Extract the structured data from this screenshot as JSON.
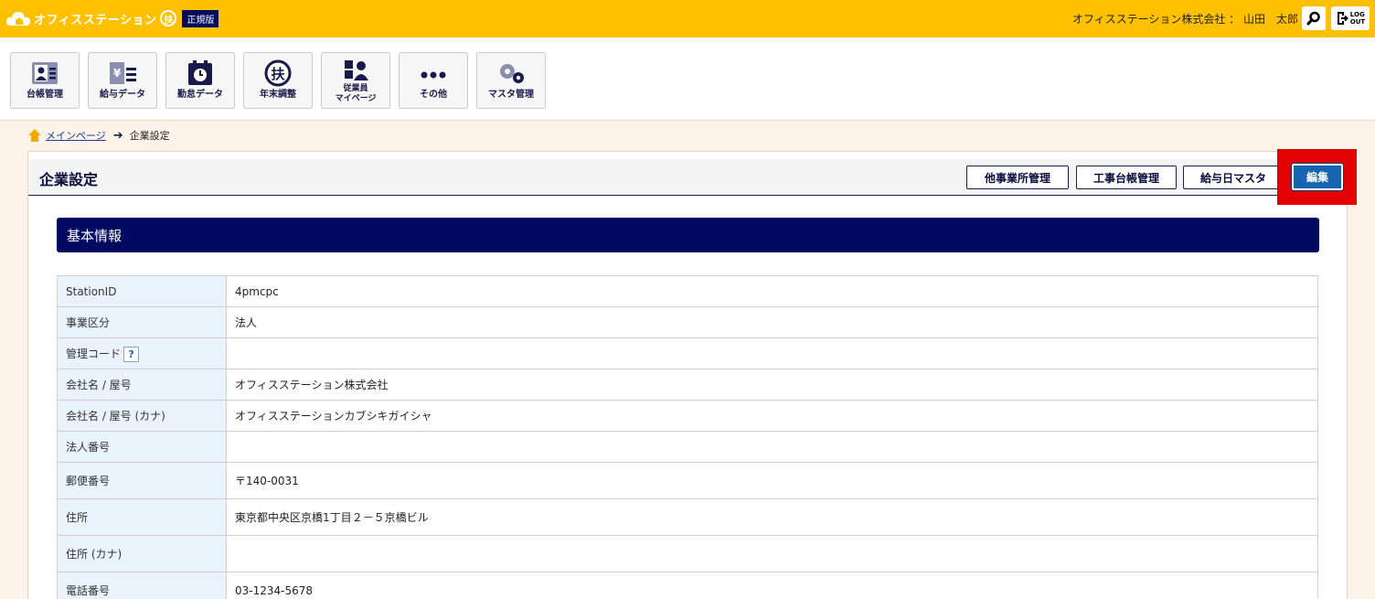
{
  "header": {
    "app_name": "オフィスステーション",
    "fu_mark": "扶",
    "edition": "正規版",
    "user": "オフィスステーション株式会社 ： 山田　太郎",
    "logout_line1": "LOG",
    "logout_line2": "OUT"
  },
  "nav": [
    {
      "label": "台帳管理",
      "icon": "ledger-icon"
    },
    {
      "label": "給与データ",
      "icon": "salary-icon"
    },
    {
      "label": "勤怠データ",
      "icon": "attendance-icon"
    },
    {
      "label": "年末調整",
      "icon": "year-end-icon"
    },
    {
      "label": "従業員\nマイページ",
      "label1": "従業員",
      "label2": "マイページ",
      "icon": "employee-icon"
    },
    {
      "label": "その他",
      "icon": "more-icon"
    },
    {
      "label": "マスタ管理",
      "icon": "master-icon"
    }
  ],
  "breadcrumb": {
    "home": "メインページ",
    "current": "企業設定"
  },
  "page": {
    "title": "企業設定",
    "buttons": {
      "other_offices": "他事業所管理",
      "construction": "工事台帳管理",
      "payday": "給与日マスタ",
      "edit": "編集"
    },
    "section_title": "基本情報"
  },
  "info_rows": [
    {
      "key": "StationID",
      "value": "4pmcpc"
    },
    {
      "key": "事業区分",
      "value": "法人"
    },
    {
      "key": "管理コード",
      "value": "",
      "help": "?"
    },
    {
      "key": "会社名 / 屋号",
      "value": "オフィスステーション株式会社"
    },
    {
      "key": "会社名 / 屋号 (カナ)",
      "value": "オフィスステーションカブシキガイシャ"
    },
    {
      "key": "法人番号",
      "value": ""
    },
    {
      "key": "郵便番号",
      "value": "〒140-0031"
    },
    {
      "key": "住所",
      "value": "東京都中央区京橋1丁目２－５京橋ビル"
    },
    {
      "key": "住所 (カナ)",
      "value": ""
    },
    {
      "key": "電話番号",
      "value": "03-1234-5678"
    }
  ],
  "colors": {
    "topbar": "#ffc000",
    "navy": "#000a60",
    "edit_button": "#1565b0",
    "highlight": "#e30000"
  }
}
